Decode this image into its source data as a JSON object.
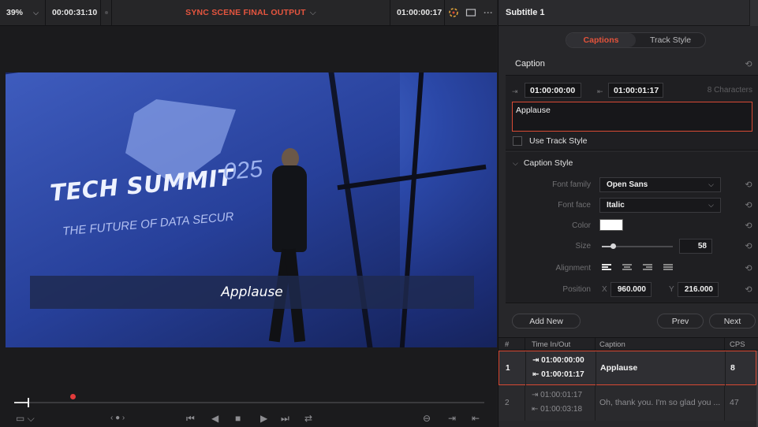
{
  "viewer": {
    "zoom": "39%",
    "timecode_left": "00:00:31:10",
    "timeline_name": "SYNC SCENE FINAL OUTPUT",
    "timecode_right": "01:00:00:17",
    "video": {
      "headline": "TECH SUMMIT",
      "year_fragment": "025",
      "subline": "THE FUTURE OF DATA SECUR",
      "caption_overlay": "Applause"
    },
    "playhead_fraction": 0.028
  },
  "inspector": {
    "title": "Subtitle 1",
    "tabs": [
      {
        "label": "Captions",
        "active": true
      },
      {
        "label": "Track Style",
        "active": false
      }
    ],
    "caption_section": {
      "title": "Caption",
      "time_in": "01:00:00:00",
      "time_out": "01:00:01:17",
      "char_count": "8 Characters",
      "text": "Applause",
      "use_track_style_label": "Use Track Style",
      "use_track_style": false
    },
    "caption_style": {
      "title": "Caption Style",
      "font_family_label": "Font family",
      "font_family": "Open Sans",
      "font_face_label": "Font face",
      "font_face": "Italic",
      "color_label": "Color",
      "color": "#ffffff",
      "size_label": "Size",
      "size": "58",
      "alignment_label": "Alignment",
      "position_label": "Position",
      "x_label": "X",
      "x_value": "960.000",
      "y_label": "Y",
      "y_value": "216.000"
    },
    "buttons": {
      "add_new": "Add New",
      "prev": "Prev",
      "next": "Next"
    },
    "table": {
      "headers": [
        "#",
        "Time In/Out",
        "Caption",
        "CPS"
      ],
      "rows": [
        {
          "num": "1",
          "time_in": "01:00:00:00",
          "time_out": "01:00:01:17",
          "caption": "Applause",
          "cps": "8"
        },
        {
          "num": "2",
          "time_in": "01:00:01:17",
          "time_out": "01:00:03:18",
          "caption": "Oh, thank you. I'm so glad you ...",
          "cps": "47"
        }
      ]
    }
  },
  "colors": {
    "accent": "#e4533b",
    "panel_bg": "#27272a",
    "viewer_bg": "#1b1b1d"
  }
}
